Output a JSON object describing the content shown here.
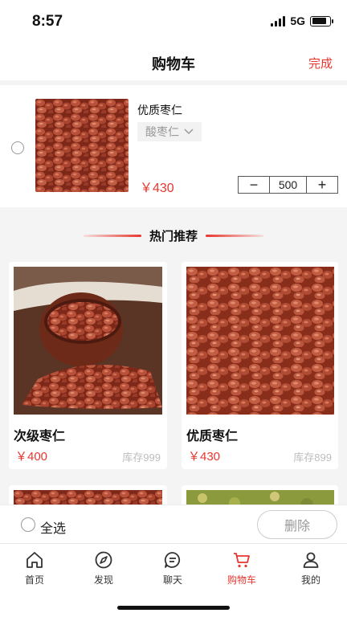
{
  "status_bar": {
    "time": "8:57",
    "network": "5G"
  },
  "nav": {
    "title": "购物车",
    "done_label": "完成"
  },
  "cart_item": {
    "name": "优质枣仁",
    "spec": "酸枣仁",
    "price": "￥430",
    "quantity": "500",
    "minus_symbol": "−",
    "plus_symbol": "+"
  },
  "recommend": {
    "title": "热门推荐",
    "products": [
      {
        "name": "次级枣仁",
        "price": "￥400",
        "stock": "库存999"
      },
      {
        "name": "优质枣仁",
        "price": "￥430",
        "stock": "库存899"
      }
    ]
  },
  "bottom_bar": {
    "select_all_label": "全选",
    "delete_label": "删除"
  },
  "tabs": [
    {
      "label": "首页",
      "icon": "home-icon"
    },
    {
      "label": "发现",
      "icon": "compass-icon"
    },
    {
      "label": "聊天",
      "icon": "chat-icon"
    },
    {
      "label": "购物车",
      "icon": "cart-icon"
    },
    {
      "label": "我的",
      "icon": "user-icon"
    }
  ],
  "colors": {
    "accent": "#e8362f",
    "background": "#f4f4f4"
  }
}
